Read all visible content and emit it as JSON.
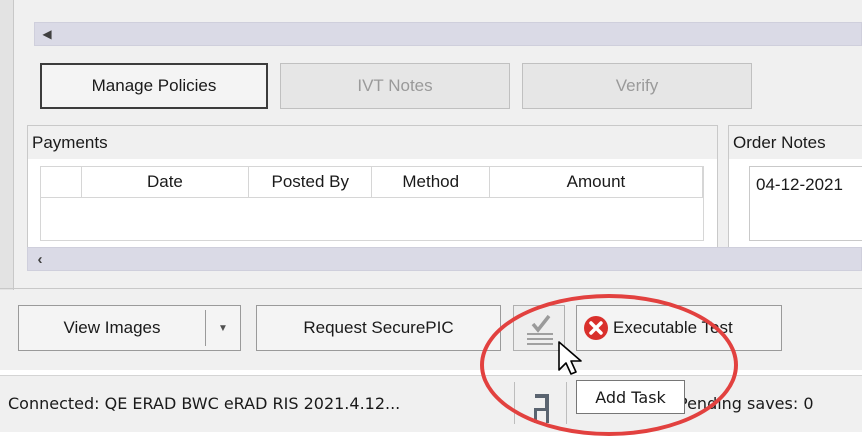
{
  "buttons": {
    "manage_policies": "Manage Policies",
    "ivt_notes": "IVT Notes",
    "verify": "Verify",
    "view_images": "View Images",
    "request_securepic": "Request SecurePIC",
    "executable_test": "Executable Test"
  },
  "payments": {
    "title": "Payments",
    "columns": [
      "",
      "Date",
      "Posted By",
      "Method",
      "Amount"
    ]
  },
  "order_notes": {
    "title": "Order Notes",
    "value": "04-12-2021"
  },
  "status": {
    "connection": "Connected: QE ERAD BWC eRAD RIS 2021.4.12...",
    "pending": "Pending saves: 0"
  },
  "tooltip": {
    "text": "Add Task"
  },
  "colors": {
    "annotation_ellipse": "#e2413f",
    "error_icon": "#d9302c",
    "scrollbar": "#dadae6"
  },
  "icons": {
    "scroll_left_top": "triangle-left-icon",
    "scroll_left_bottom": "chevron-left-icon",
    "dropdown": "caret-down-icon",
    "add_task": "checklist-icon",
    "error": "error-x-icon",
    "status_chair": "chair-icon",
    "cursor": "mouse-pointer-icon"
  }
}
